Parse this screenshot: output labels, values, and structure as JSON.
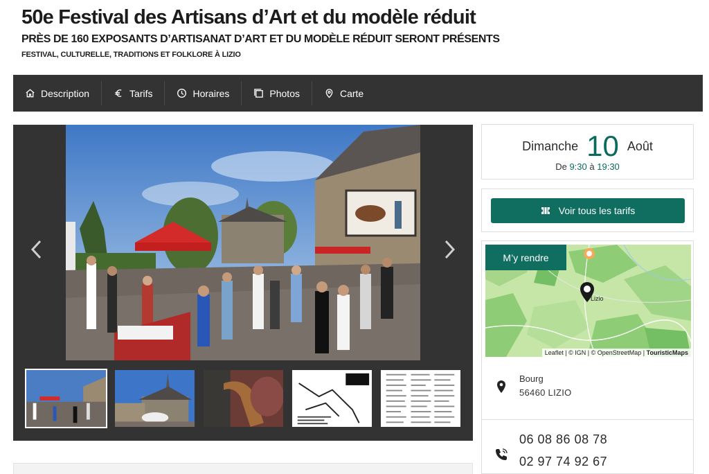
{
  "header": {
    "title": "50e Festival des Artisans d’Art et du modèle réduit",
    "subtitle": "PRÈS DE 160 EXPOSANTS D’ARTISANAT D’ART ET DU MODÈLE RÉDUIT SERONT PRÉSENTS",
    "tags": "FESTIVAL, CULTURELLE, TRADITIONS ET FOLKLORE À LIZIO"
  },
  "nav": {
    "items": [
      {
        "label": "Description",
        "icon": "home-icon"
      },
      {
        "label": "Tarifs",
        "icon": "euro-icon"
      },
      {
        "label": "Horaires",
        "icon": "clock-icon"
      },
      {
        "label": "Photos",
        "icon": "photos-icon"
      },
      {
        "label": "Carte",
        "icon": "map-pin-icon"
      }
    ]
  },
  "gallery": {
    "thumbnail_count": 5,
    "active_index": 0
  },
  "event_date": {
    "weekday": "Dimanche",
    "day": "10",
    "month": "Août",
    "prefix": "De",
    "start": "9:30",
    "sep": "à",
    "end": "19:30"
  },
  "tarifs": {
    "button_label": "Voir tous les tarifs"
  },
  "map": {
    "button_label": "M’y rendre",
    "place_label": "Lizio",
    "attribution_leaflet": "Leaflet",
    "attribution_rest": " | © IGN | © OpenStreetMap | ",
    "attribution_brand": "TouristicMaps"
  },
  "address": {
    "line1": "Bourg",
    "line2": "56460  LIZIO"
  },
  "phones": {
    "phone1": "06 08 86 08 78",
    "phone2": "02 97 74 92 67"
  },
  "colors": {
    "accent": "#0f6e5f",
    "nav_bg": "#333333",
    "gallery_bg": "#333333"
  }
}
